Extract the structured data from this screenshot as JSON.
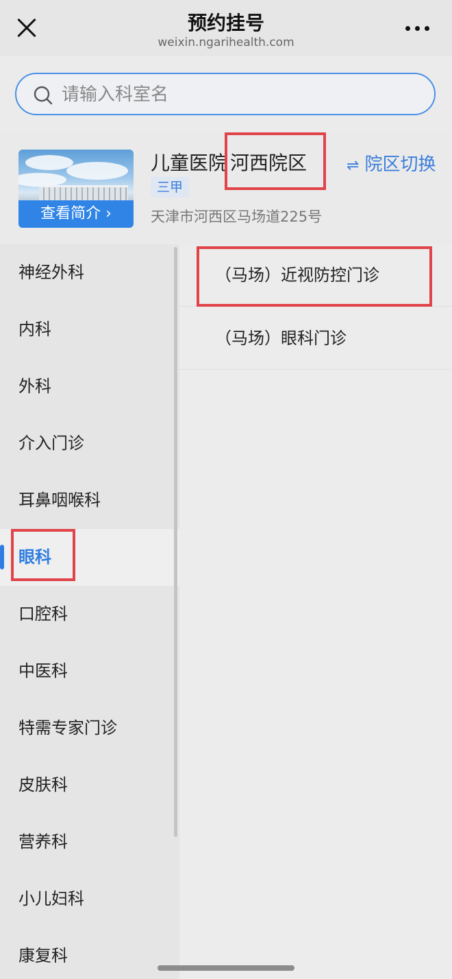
{
  "header": {
    "title": "预约挂号",
    "domain": "weixin.ngarihealth.com"
  },
  "search": {
    "placeholder": "请输入科室名"
  },
  "hospital": {
    "name": "儿童医院",
    "campus": "河西院区",
    "grade": "三甲",
    "address": "天津市河西区马场道225号",
    "intro_button": "查看简介 ›",
    "switch_label": "院区切换",
    "switch_icon": "swap-icon"
  },
  "departments": [
    {
      "label": "神经外科"
    },
    {
      "label": "内科"
    },
    {
      "label": "外科"
    },
    {
      "label": "介入门诊"
    },
    {
      "label": "耳鼻咽喉科"
    },
    {
      "label": "眼科",
      "active": true
    },
    {
      "label": "口腔科"
    },
    {
      "label": "中医科"
    },
    {
      "label": "特需专家门诊"
    },
    {
      "label": "皮肤科"
    },
    {
      "label": "营养科"
    },
    {
      "label": "小儿妇科"
    },
    {
      "label": "康复科"
    }
  ],
  "clinics": [
    {
      "label": "（马场）近视防控门诊"
    },
    {
      "label": "（马场）眼科门诊"
    }
  ],
  "colors": {
    "accent": "#2f7de1",
    "highlight_box": "#e0444a"
  }
}
